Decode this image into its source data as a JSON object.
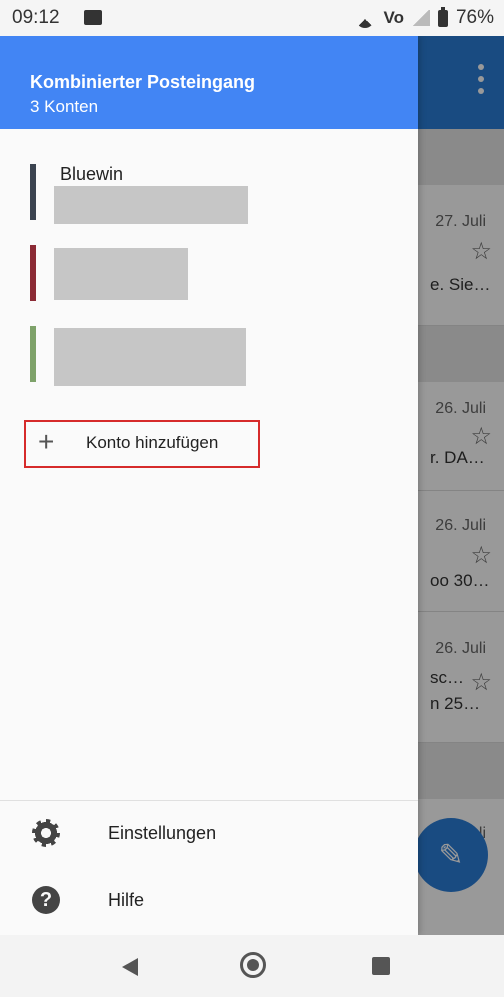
{
  "status_bar": {
    "time": "09:12",
    "network": "Vo",
    "battery": "76%"
  },
  "drawer": {
    "title": "Kombinierter Posteingang",
    "subtitle": "3 Konten",
    "accounts": [
      {
        "name": "Bluewin",
        "color": "#3b4350"
      },
      {
        "name": "",
        "color": "#8b2a35"
      },
      {
        "name": "",
        "color": "#7ea26a"
      }
    ],
    "add_account_label": "Konto hinzufügen",
    "settings_label": "Einstellungen",
    "help_label": "Hilfe"
  },
  "inbox_background": {
    "rows": [
      {
        "date": "27. Juli",
        "snippet": "e. Sie…"
      },
      {
        "date": "26. Juli",
        "snippet": "r. DA…"
      },
      {
        "date": "26. Juli",
        "snippet": "oo 30…"
      },
      {
        "date": "26. Juli",
        "snippet": "sc…",
        "snippet2": "n 25…"
      },
      {
        "date": "24. Juli",
        "snippet": ""
      }
    ]
  },
  "colors": {
    "header_blue": "#4285f4",
    "highlight_border": "#d62b2b"
  }
}
